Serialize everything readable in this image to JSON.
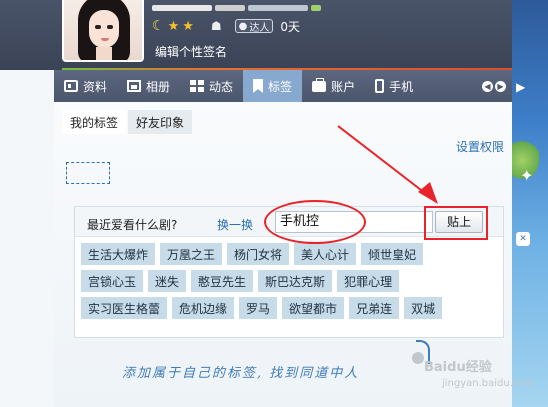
{
  "profile": {
    "level_icons": [
      "moon-icon",
      "star-icon",
      "star-icon"
    ],
    "badge": "达人",
    "days": "0天",
    "signature": "编辑个性签名"
  },
  "nav": {
    "tabs": [
      {
        "label": "资料",
        "icon": "card-icon"
      },
      {
        "label": "相册",
        "icon": "photo-icon"
      },
      {
        "label": "动态",
        "icon": "grid-icon"
      },
      {
        "label": "标签",
        "icon": "bookmark-icon",
        "active": true
      },
      {
        "label": "账户",
        "icon": "briefcase-icon"
      },
      {
        "label": "手机",
        "icon": "phone-icon"
      }
    ]
  },
  "subtabs": {
    "my_tags": "我的标签",
    "friend_impression": "好友印象"
  },
  "settings_link": "设置权限",
  "tag_panel": {
    "question": "最近爱看什么剧?",
    "change": "换一换",
    "input_value": "手机控",
    "stick_button": "贴上",
    "tags": [
      [
        "生活大爆炸",
        "万凰之王",
        "杨门女将",
        "美人心计",
        "倾世皇妃"
      ],
      [
        "宫锁心玉",
        "迷失",
        "憨豆先生",
        "斯巴达克斯",
        "犯罪心理"
      ],
      [
        "实习医生格蕾",
        "危机边缘",
        "罗马",
        "欲望都市",
        "兄弟连",
        "双城"
      ]
    ]
  },
  "slogan": "添加属于自己的标签, 找到同道中人",
  "watermark": "Baidu经验",
  "watermark_sub": "jingyan.baidu.com",
  "colors": {
    "accent_link": "#2a6fb8",
    "annotation_red": "#e8242a",
    "tag_bg": "#c7dbe8",
    "active_tab": "#87a9cf"
  }
}
